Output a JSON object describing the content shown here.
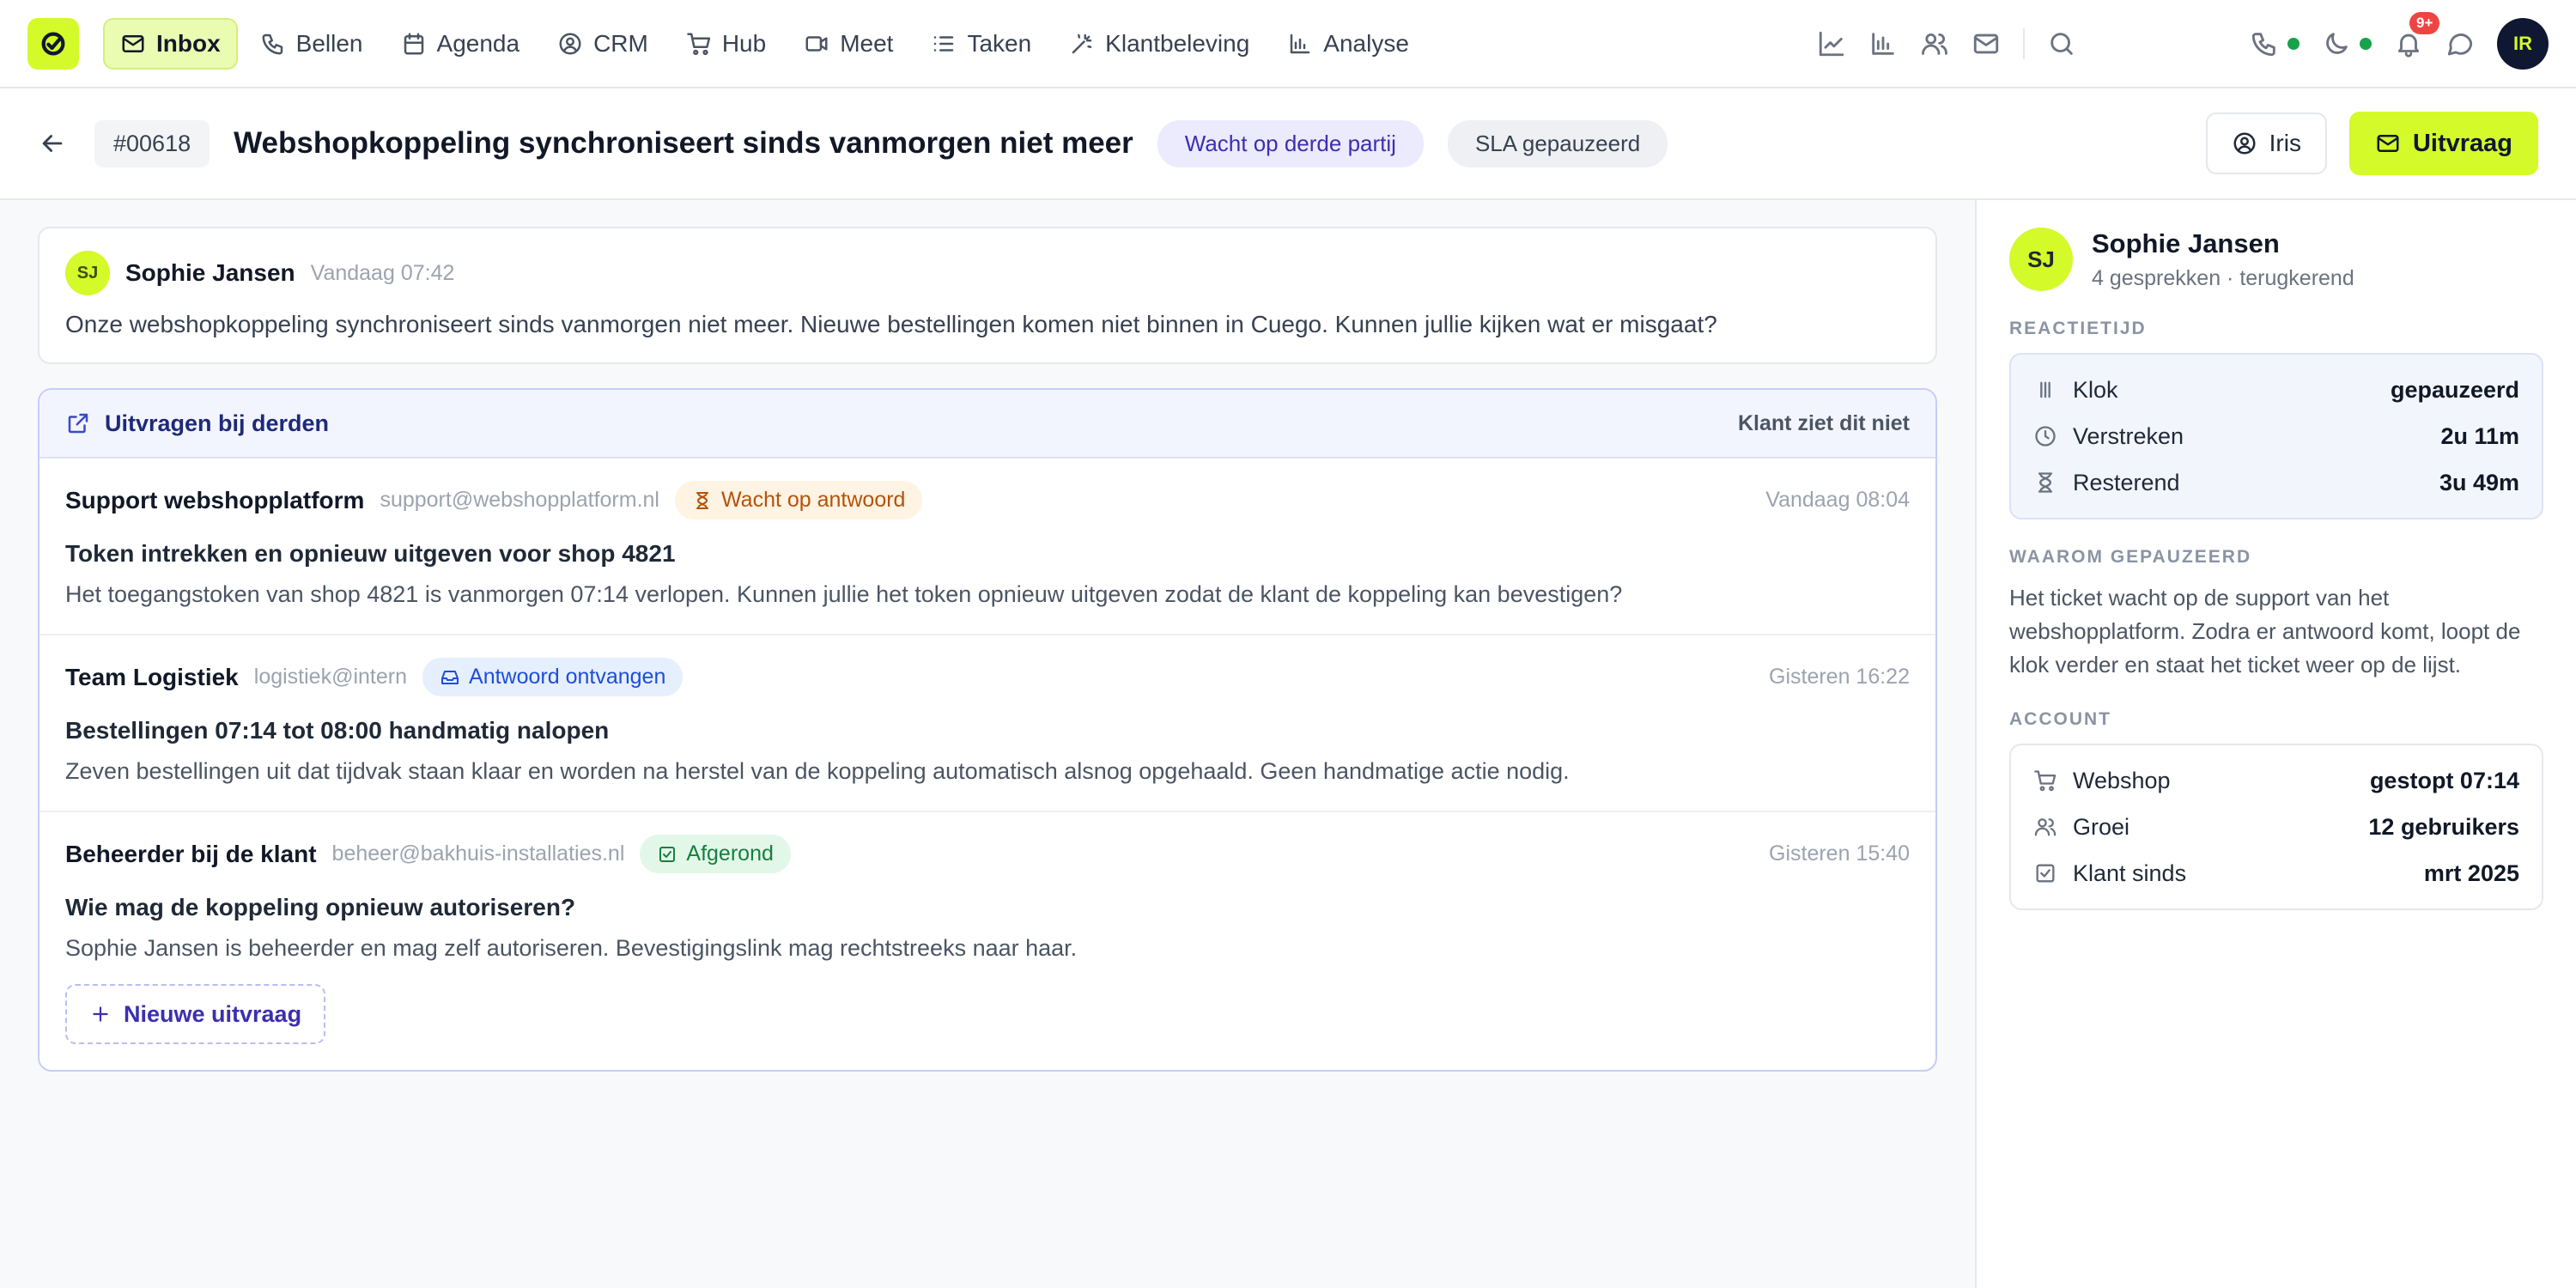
{
  "nav": {
    "items": [
      {
        "label": "Inbox",
        "icon": "mail-icon",
        "active": true
      },
      {
        "label": "Bellen",
        "icon": "phone-icon"
      },
      {
        "label": "Agenda",
        "icon": "calendar-icon"
      },
      {
        "label": "CRM",
        "icon": "contact-icon"
      },
      {
        "label": "Hub",
        "icon": "cart-icon"
      },
      {
        "label": "Meet",
        "icon": "video-icon"
      },
      {
        "label": "Taken",
        "icon": "list-icon"
      },
      {
        "label": "Klantbeleving",
        "icon": "sparkle-icon"
      },
      {
        "label": "Analyse",
        "icon": "bar-chart-icon"
      }
    ],
    "notification_count": "9+",
    "user_initials": "IR",
    "colors": {
      "accent": "#d4fa2a",
      "online": "#16a34a",
      "badge": "#ef4444"
    }
  },
  "ticket": {
    "id": "#00618",
    "title": "Webshopkoppeling synchroniseert sinds vanmorgen niet meer",
    "status_pill": "Wacht op derde partij",
    "sla_pill": "SLA gepauzeerd",
    "assignee": "Iris",
    "action_button": "Uitvraag"
  },
  "message": {
    "initials": "SJ",
    "author": "Sophie Jansen",
    "time": "Vandaag 07:42",
    "body": "Onze webshopkoppeling synchroniseert sinds vanmorgen niet meer. Nieuwe bestellingen komen niet binnen in Cuego. Kunnen jullie kijken wat er misgaat?"
  },
  "inquiries": {
    "title": "Uitvragen bij derden",
    "note": "Klant ziet dit niet",
    "items": [
      {
        "who": "Support webshopplatform",
        "email": "support@webshopplatform.nl",
        "status": "Wacht op antwoord",
        "time": "Vandaag 08:04",
        "subject": "Token intrekken en opnieuw uitgeven voor shop 4821",
        "body": "Het toegangstoken van shop 4821 is vanmorgen 07:14 verlopen. Kunnen jullie het token opnieuw uitgeven zodat de klant de koppeling kan bevestigen?"
      },
      {
        "who": "Team Logistiek",
        "email": "logistiek@intern",
        "status": "Antwoord ontvangen",
        "time": "Gisteren 16:22",
        "subject": "Bestellingen 07:14 tot 08:00 handmatig nalopen",
        "body": "Zeven bestellingen uit dat tijdvak staan klaar en worden na herstel van de koppeling automatisch alsnog opgehaald. Geen handmatige actie nodig."
      },
      {
        "who": "Beheerder bij de klant",
        "email": "beheer@bakhuis-installaties.nl",
        "status": "Afgerond",
        "time": "Gisteren 15:40",
        "subject": "Wie mag de koppeling opnieuw autoriseren?",
        "body": "Sophie Jansen is beheerder en mag zelf autoriseren. Bevestigingslink mag rechtstreeks naar haar."
      }
    ],
    "new_button": "Nieuwe uitvraag"
  },
  "sidebar": {
    "initials": "SJ",
    "name": "Sophie Jansen",
    "meta": "4 gesprekken · terugkerend",
    "reaction_label": "REACTIETIJD",
    "reaction": [
      {
        "label": "Klok",
        "value": "gepauzeerd",
        "icon": "pause-icon"
      },
      {
        "label": "Verstreken",
        "value": "2u 11m",
        "icon": "clock-icon"
      },
      {
        "label": "Resterend",
        "value": "3u 49m",
        "icon": "hourglass-icon"
      }
    ],
    "why_label": "WAAROM GEPAUZEERD",
    "why_text": "Het ticket wacht op de support van het webshopplatform. Zodra er antwoord komt, loopt de klok verder en staat het ticket weer op de lijst.",
    "account_label": "ACCOUNT",
    "account": [
      {
        "label": "Webshop",
        "value": "gestopt 07:14",
        "icon": "cart-icon"
      },
      {
        "label": "Groei",
        "value": "12 gebruikers",
        "icon": "users-icon"
      },
      {
        "label": "Klant sinds",
        "value": "mrt 2025",
        "icon": "check-square-icon"
      }
    ]
  }
}
